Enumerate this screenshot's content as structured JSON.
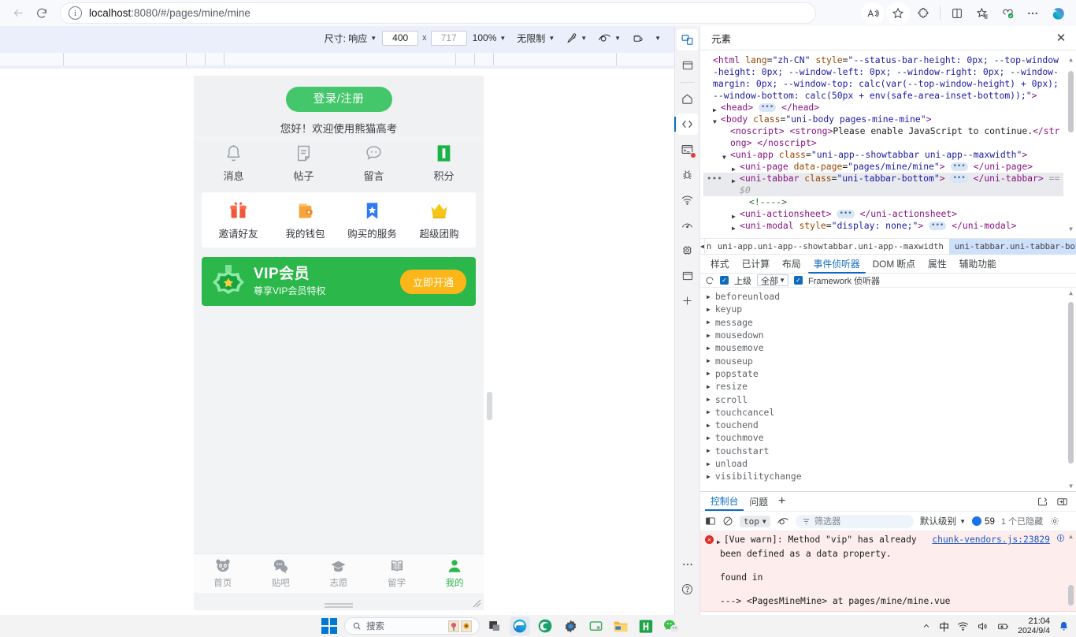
{
  "browser": {
    "url_prefix": "localhost",
    "url_rest": ":8080/#/pages/mine/mine",
    "back_icon": "back-arrow-icon",
    "reload_icon": "reload-icon",
    "info_icon": "info-icon",
    "read_aloud_icon": "read-aloud-icon",
    "favorite_icon": "star-icon",
    "extensions_icon": "extensions-icon",
    "split_screen_icon": "split-screen-icon",
    "collections_icon": "collections-icon",
    "browser_essentials_icon": "browser-essentials-icon",
    "settings_more_icon": "more-options-icon",
    "copilot_icon": "copilot-icon"
  },
  "emulation": {
    "size_label": "尺寸: 响应",
    "width_value": "400",
    "x_separator": "x",
    "height_value": "717",
    "zoom_value": "100%",
    "throttle_label": "无限制",
    "pen_icon": "eyedropper-icon",
    "vision_icon": "vision-deficiency-icon",
    "screenshot_icon": "capture-screenshot-icon",
    "more_icon": "more-icon"
  },
  "phone": {
    "login_button": "登录/注册",
    "greeting": "您好！欢迎使用熊猫高考",
    "quick_items": [
      {
        "label": "消息",
        "icon": "bell-icon"
      },
      {
        "label": "帖子",
        "icon": "note-icon"
      },
      {
        "label": "留言",
        "icon": "comment-icon"
      },
      {
        "label": "积分",
        "icon": "points-icon"
      }
    ],
    "service_items": [
      {
        "label": "邀请好友",
        "icon": "gift-icon"
      },
      {
        "label": "我的钱包",
        "icon": "wallet-icon"
      },
      {
        "label": "购买的服务",
        "icon": "bookmark-star-icon"
      },
      {
        "label": "超级团购",
        "icon": "crown-icon"
      }
    ],
    "vip": {
      "title": "VIP会员",
      "subtitle": "尊享VIP会员特权",
      "button": "立即开通",
      "badge_icon": "vip-medal-icon",
      "bg_color": "#2cb74b",
      "button_color": "#fcb619"
    },
    "tabbar": [
      {
        "label": "首页",
        "icon": "panda-icon",
        "active": false
      },
      {
        "label": "贴吧",
        "icon": "chat-icon",
        "active": false
      },
      {
        "label": "志愿",
        "icon": "graduation-cap-icon",
        "active": false
      },
      {
        "label": "留学",
        "icon": "open-book-icon",
        "active": false
      },
      {
        "label": "我的",
        "icon": "person-icon",
        "active": true
      }
    ],
    "active_color": "#2cb74b"
  },
  "devtools": {
    "rail": [
      {
        "name": "device-emulation-icon",
        "selected": true
      },
      {
        "name": "window-icon",
        "selected": false
      },
      {
        "name": "home-icon",
        "selected": false
      },
      {
        "name": "elements-code-icon",
        "selected": true
      },
      {
        "name": "console-icon",
        "selected": false,
        "badge": true
      },
      {
        "name": "sources-bug-icon",
        "selected": false
      },
      {
        "name": "network-icon",
        "selected": false
      },
      {
        "name": "performance-icon",
        "selected": false
      },
      {
        "name": "memory-chip-icon",
        "selected": false
      },
      {
        "name": "application-icon",
        "selected": false
      },
      {
        "name": "add-panel-icon",
        "selected": false
      }
    ],
    "rail_bottom": [
      {
        "name": "more-tools-icon"
      },
      {
        "name": "help-icon"
      }
    ],
    "panel_title": "元素",
    "close_icon": "close-icon",
    "dom": {
      "lines": [
        {
          "id": "l1",
          "text": "<html lang=\"zh-CN\" style=\"--status-bar-height: 0px; --top-window-height: 0px; --window-left: 0px; --window-right: 0px; --window-margin: 0px; --window-top: calc(var(--top-window-height) + 0px); --window-bottom: calc(50px + env(safe-area-inset-bottom));\">"
        },
        {
          "id": "l2",
          "text": "<head> … </head>"
        },
        {
          "id": "l3",
          "text": "<body class=\"uni-body pages-mine-mine\">"
        },
        {
          "id": "l4",
          "text": "<noscript> <strong>Please enable JavaScript to continue.</strong> </noscript>"
        },
        {
          "id": "l5",
          "text": "<uni-app class=\"uni-app--showtabbar uni-app--maxwidth\">"
        },
        {
          "id": "l6",
          "text": "<uni-page data-page=\"pages/mine/mine\"> … </uni-page>"
        },
        {
          "id": "l7",
          "text": "<uni-tabbar class=\"uni-tabbar-bottom\"> … </uni-tabbar> == $0"
        },
        {
          "id": "l8",
          "text": "<!---->"
        },
        {
          "id": "l9",
          "text": "<uni-actionsheet> … </uni-actionsheet>"
        },
        {
          "id": "l10",
          "text": "<uni-modal style=\"display: none;\"> … </uni-modal>"
        }
      ]
    },
    "breadcrumb": {
      "items": [
        "ne",
        "uni-app.uni-app--showtabbar.uni-app--maxwidth",
        "uni-tabbar.uni-tabbar-bottom"
      ],
      "active_index": 2
    },
    "tabs": [
      {
        "label": "样式",
        "active": false
      },
      {
        "label": "已计算",
        "active": false
      },
      {
        "label": "布局",
        "active": false
      },
      {
        "label": "事件侦听器",
        "active": true
      },
      {
        "label": "DOM 断点",
        "active": false
      },
      {
        "label": "属性",
        "active": false
      },
      {
        "label": "辅助功能",
        "active": false
      }
    ],
    "listener_toolbar": {
      "refresh_icon": "refresh-icon",
      "ancestors_label": "上级",
      "scope_value": "全部",
      "framework_label": "Framework 侦听器"
    },
    "listeners": [
      "beforeunload",
      "keyup",
      "message",
      "mousedown",
      "mousemove",
      "mouseup",
      "popstate",
      "resize",
      "scroll",
      "touchcancel",
      "touchend",
      "touchmove",
      "touchstart",
      "unload",
      "visibilitychange"
    ]
  },
  "drawer": {
    "tabs": [
      {
        "label": "控制台",
        "active": true
      },
      {
        "label": "问题",
        "active": false
      }
    ],
    "add_tab_icon": "plus-icon",
    "right_icons": [
      "console-settings-icon",
      "dock-side-icon"
    ],
    "console_bar": {
      "sidebar_icon": "console-sidebar-icon",
      "clear_icon": "clear-console-icon",
      "context_value": "top",
      "eye_icon": "live-expression-icon",
      "filter_icon": "filter-icon",
      "filter_placeholder": "筛选器",
      "level_label": "默认级别",
      "message_count": "59",
      "hidden_label": "1 个已隐藏",
      "settings_icon": "settings-gear-icon"
    },
    "message": {
      "line1": "[Vue warn]: Method \"vip\" has already",
      "line2": "been defined as a data property.",
      "line3": "found in",
      "line4": "---> <PagesMineMine> at pages/mine/mine.vue",
      "source": "chunk-vendors.js:23829",
      "icon": "error-icon",
      "prompt": ">"
    }
  },
  "taskbar": {
    "start_icon": "windows-start-icon",
    "search_icon": "search-icon",
    "search_placeholder": "搜索",
    "apps": [
      {
        "name": "taskview-icon"
      },
      {
        "name": "edge-icon",
        "active": true
      },
      {
        "name": "edge-dev-icon"
      },
      {
        "name": "settings-app-icon"
      },
      {
        "name": "screen-app-icon"
      },
      {
        "name": "file-explorer-icon"
      },
      {
        "name": "h-app-icon"
      },
      {
        "name": "wechat-icon"
      }
    ],
    "tray": {
      "overflow_icon": "chevron-up-icon",
      "ime_label": "中",
      "wifi_icon": "wifi-icon",
      "volume_icon": "volume-icon",
      "battery_icon": "battery-icon",
      "time": "21:04",
      "date": "2024/9/4",
      "notification_icon": "bell-notification-icon"
    }
  }
}
